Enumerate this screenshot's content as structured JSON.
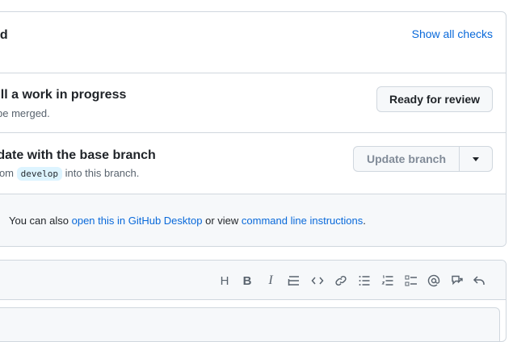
{
  "checks": {
    "title_fragment": "ed",
    "show_all_label": "Show all checks"
  },
  "draft": {
    "title_fragment": "till a work in progress",
    "subtitle_fragment": "be merged.",
    "button_label": "Ready for review"
  },
  "branch": {
    "title_fragment": "-date with the base branch",
    "subtitle_prefix": "from",
    "branch_name": "develop",
    "subtitle_suffix": "into this branch.",
    "button_label": "Update branch",
    "button_state": "disabled"
  },
  "tips": {
    "prefix": "You can also",
    "desktop_link": "open this in GitHub Desktop",
    "middle": "or view",
    "cli_link": "command line instructions",
    "suffix": "."
  },
  "toolbar": {
    "heading_glyph": "H",
    "bold_glyph": "B",
    "italic_glyph": "I",
    "tools": [
      "heading-icon",
      "bold-icon",
      "italic-icon",
      "quote-icon",
      "code-icon",
      "link-icon",
      "unordered-list-icon",
      "ordered-list-icon",
      "task-list-icon",
      "mention-icon",
      "cross-reference-icon",
      "reply-icon"
    ]
  },
  "colors": {
    "link": "#0969da",
    "border": "#d0d7de",
    "muted": "#59636e",
    "branch_bg": "#ddf4ff"
  }
}
